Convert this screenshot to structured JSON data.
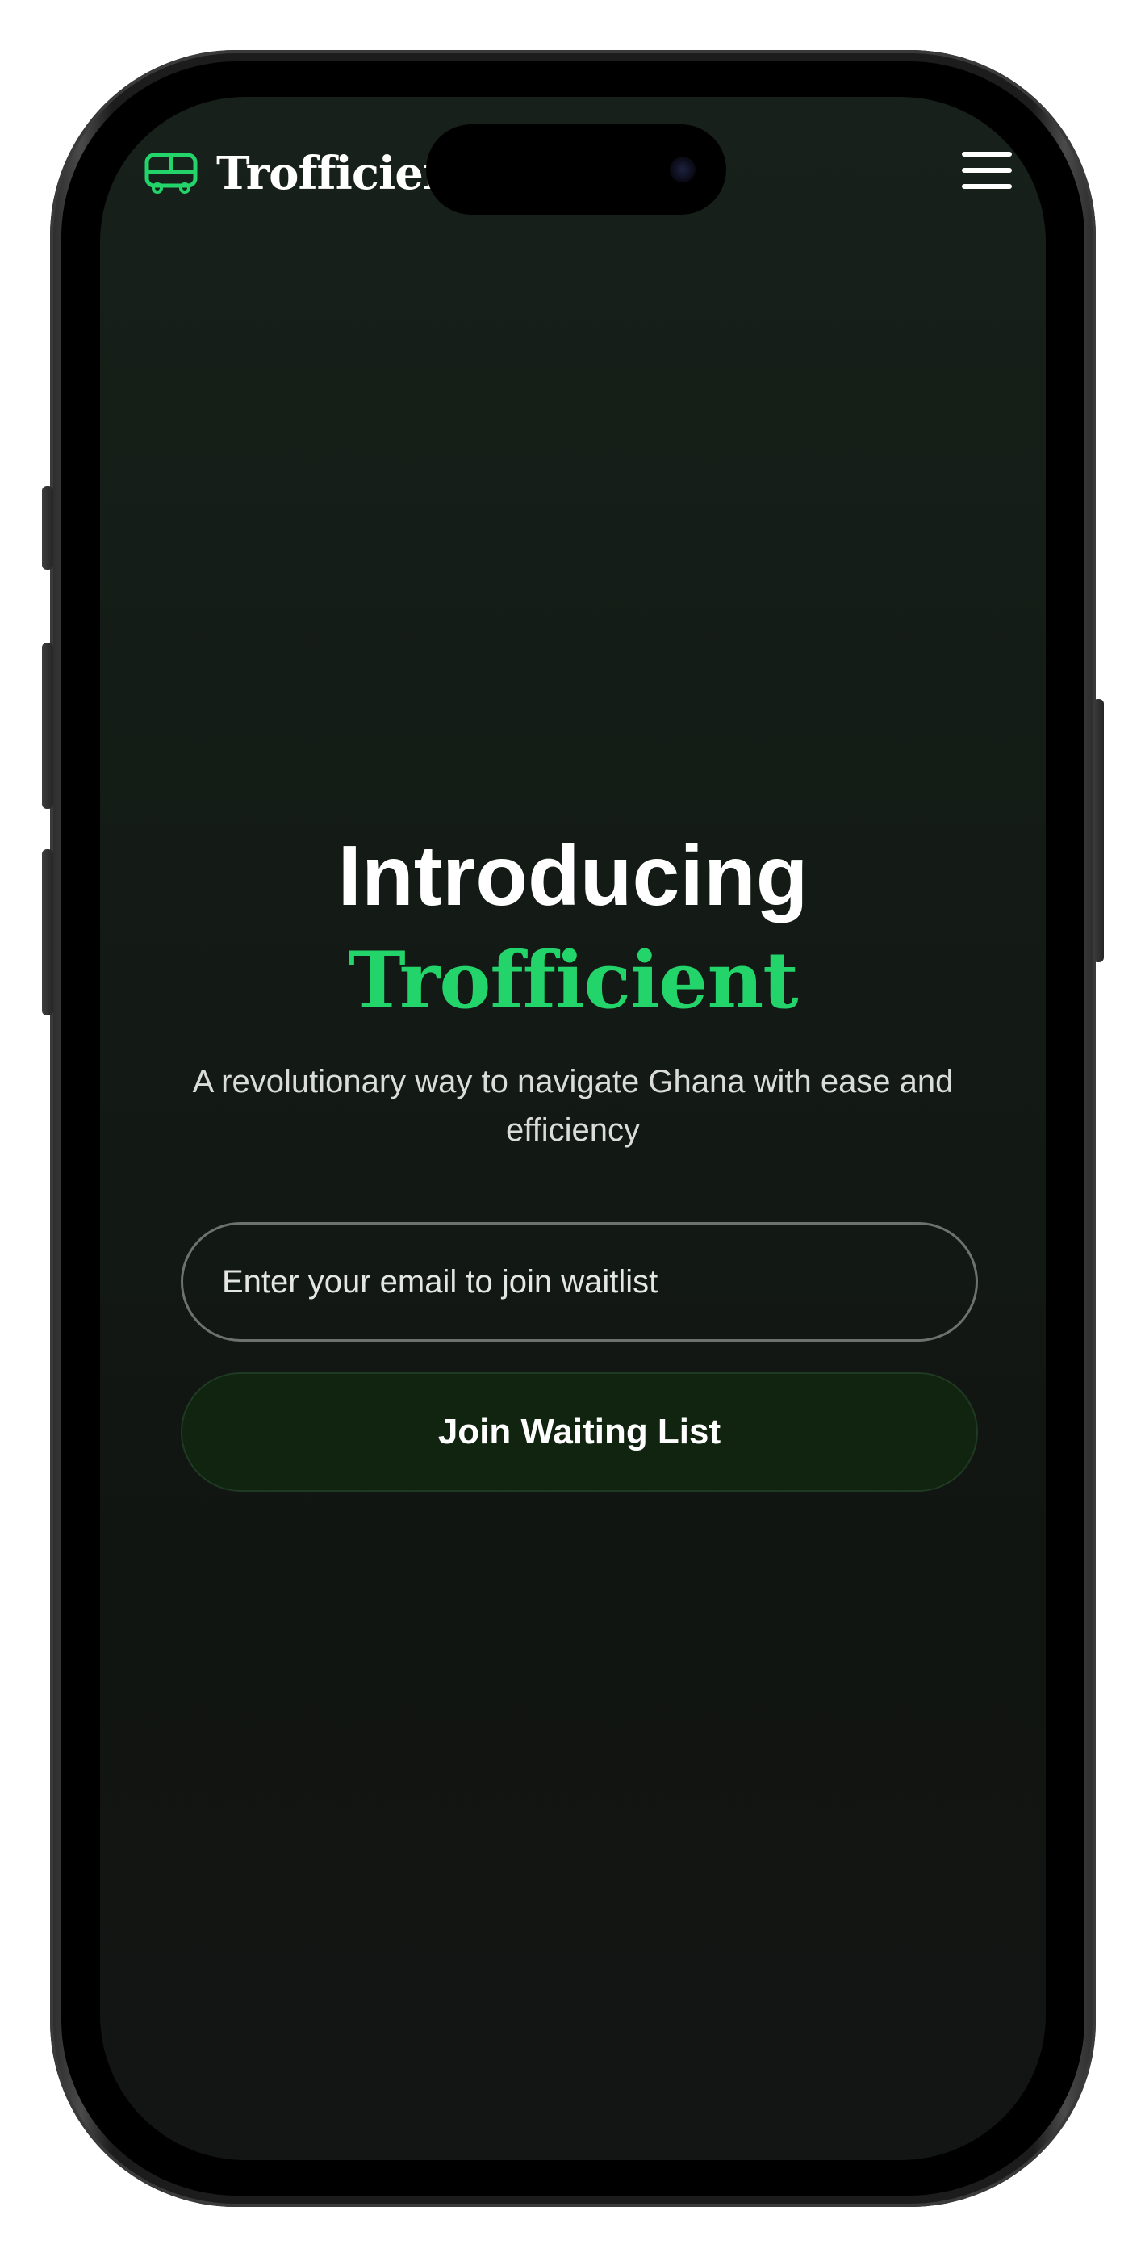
{
  "header": {
    "brand": "Trofficient",
    "logo_icon": "bus-icon",
    "menu_icon": "hamburger-menu-icon"
  },
  "hero": {
    "title": "Introducing",
    "brand": "Trofficient",
    "subtitle": "A revolutionary way to navigate Ghana with ease and efficiency"
  },
  "form": {
    "email_placeholder": "Enter your email to join waitlist",
    "email_value": "",
    "button_label": "Join Waiting List"
  },
  "colors": {
    "accent": "#23d46b",
    "background": "#131a15",
    "button_bg": "#11240f",
    "text": "#ffffff"
  }
}
